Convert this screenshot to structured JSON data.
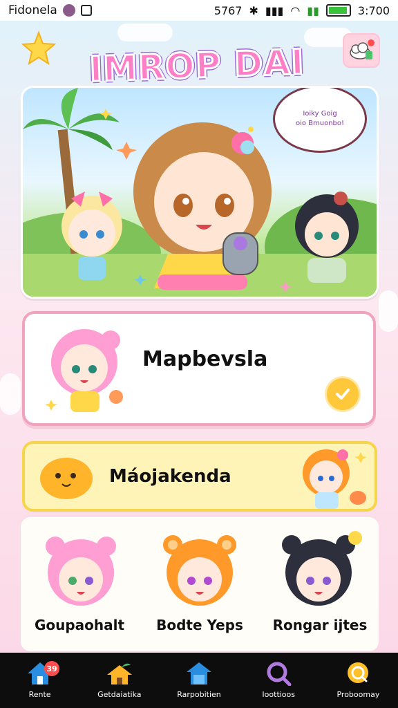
{
  "status_bar": {
    "carrier": "Fidonela",
    "signal_text": "5767",
    "time": "3:700"
  },
  "header": {
    "title": "IMROP DAI",
    "star_icon": "star-icon",
    "chat_icon": "cloud-chat-icon"
  },
  "hero": {
    "speech_line1": "Ioiky Goig",
    "speech_line2": "oio Bmuonbo!"
  },
  "feature_card": {
    "label": "Mapbevsla"
  },
  "promo_card": {
    "label": "Máojakenda"
  },
  "characters": [
    {
      "name": "Goupaohalt"
    },
    {
      "name": "Bodte Yeps"
    },
    {
      "name": "Rongar ijtes"
    }
  ],
  "nav": [
    {
      "label": "Rente",
      "badge": "39",
      "icon": "home-icon"
    },
    {
      "label": "Getdaiatika",
      "icon": "house-plant-icon"
    },
    {
      "label": "Rarpobitien",
      "icon": "house-map-icon"
    },
    {
      "label": "Ioottioos",
      "icon": "search-icon"
    },
    {
      "label": "Proboomay",
      "icon": "search-chat-icon"
    }
  ],
  "colors": {
    "accent_pink": "#f0a3bd",
    "accent_yellow": "#f7d54a",
    "nav_bg": "#0d0d0d",
    "title_pink": "#ff7fc6"
  }
}
